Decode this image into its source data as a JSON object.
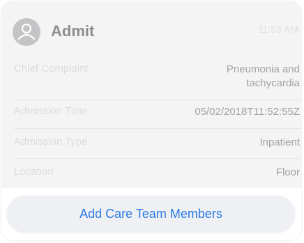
{
  "header": {
    "icon": "user-icon",
    "title": "Admit",
    "time": "11:53 AM"
  },
  "rows": [
    {
      "label": "Chief Complaint",
      "value": "Pneumonia and tachycardia",
      "value_line1": "Pneumonia and",
      "value_line2": "tachycardia"
    },
    {
      "label": "Admission Time",
      "value": "05/02/2018T11:52:55Z"
    },
    {
      "label": "Admission Type",
      "value": "Inpatient"
    },
    {
      "label": "Location",
      "value": "Floor"
    }
  ],
  "actions": {
    "add_care_team_label": "Add Care Team Members"
  },
  "colors": {
    "accent": "#2c7be5",
    "card_background": "#f4f4f5",
    "button_background": "#eef0f4"
  }
}
